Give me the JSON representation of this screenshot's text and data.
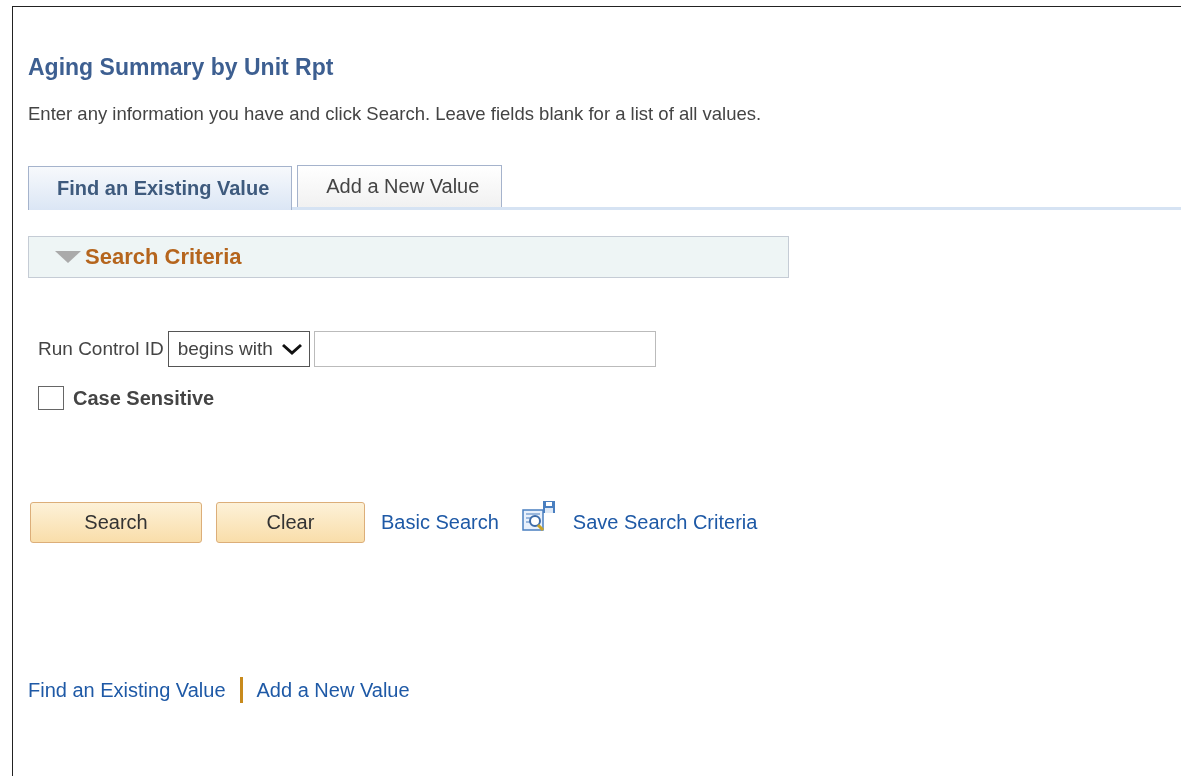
{
  "page": {
    "title": "Aging Summary by Unit Rpt",
    "instructions": "Enter any information you have and click Search. Leave fields blank for a list of all values."
  },
  "tabs": [
    {
      "label": "Find an Existing Value",
      "selected": true
    },
    {
      "label": "Add a New Value",
      "selected": false
    }
  ],
  "section": {
    "title": "Search Criteria",
    "expanded": true
  },
  "criteria": {
    "label": "Run Control ID",
    "operator": "begins with"
  },
  "case_sensitive": {
    "label": "Case Sensitive",
    "checked": false
  },
  "buttons": [
    "Search",
    "Clear"
  ],
  "links": [
    "Basic Search",
    "Save Search Criteria"
  ],
  "footer_links": [
    "Find an Existing Value",
    "Add a New Value"
  ]
}
